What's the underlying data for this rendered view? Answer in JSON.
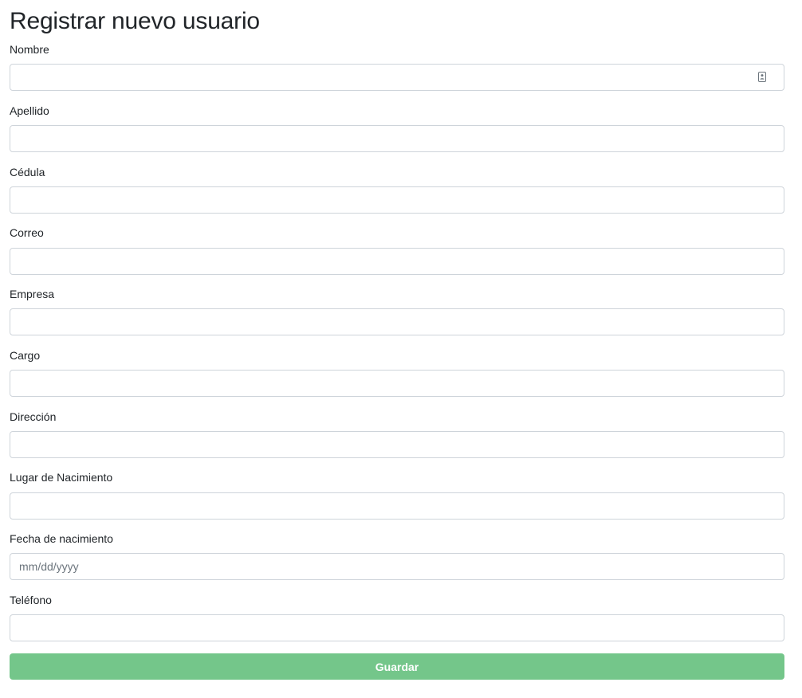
{
  "form": {
    "title": "Registrar nuevo usuario",
    "fields": [
      {
        "label": "Nombre",
        "value": "",
        "placeholder": ""
      },
      {
        "label": "Apellido",
        "value": "",
        "placeholder": ""
      },
      {
        "label": "Cédula",
        "value": "",
        "placeholder": ""
      },
      {
        "label": "Correo",
        "value": "",
        "placeholder": ""
      },
      {
        "label": "Empresa",
        "value": "",
        "placeholder": ""
      },
      {
        "label": "Cargo",
        "value": "",
        "placeholder": ""
      },
      {
        "label": "Dirección",
        "value": "",
        "placeholder": ""
      },
      {
        "label": "Lugar de Nacimiento",
        "value": "",
        "placeholder": ""
      },
      {
        "label": "Fecha de nacimiento",
        "value": "",
        "placeholder": "mm/dd/yyyy"
      },
      {
        "label": "Teléfono",
        "value": "",
        "placeholder": ""
      }
    ],
    "save_label": "Guardar"
  },
  "icons": {
    "name_field_icon": "contact-card-icon"
  },
  "colors": {
    "button_bg": "#74c68a",
    "button_text": "#ffffff",
    "input_border": "#ced4da",
    "text": "#212529"
  }
}
